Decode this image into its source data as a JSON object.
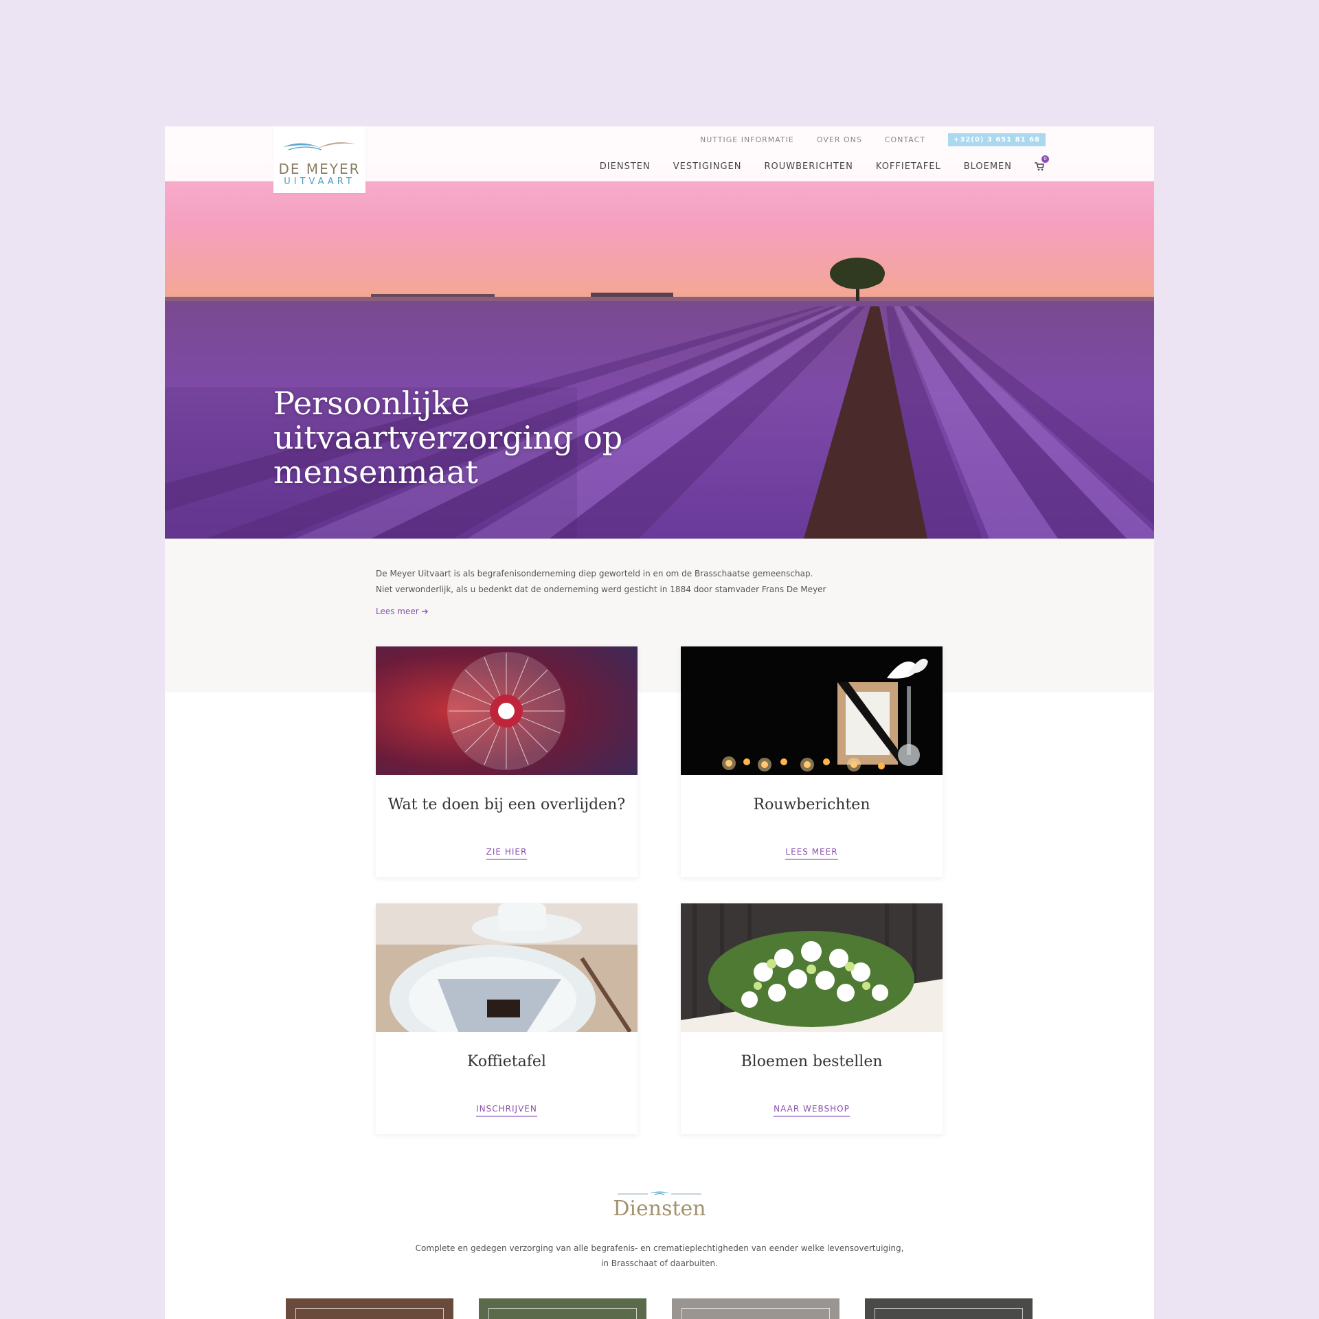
{
  "brand": {
    "line1": "DE MEYER",
    "line2": "UITVAART"
  },
  "topnav": {
    "items": [
      "NUTTIGE INFORMATIE",
      "OVER ONS",
      "CONTACT"
    ],
    "phone": "+32(0) 3 651 81 68"
  },
  "mainnav": {
    "items": [
      "DIENSTEN",
      "VESTIGINGEN",
      "ROUWBERICHTEN",
      "KOFFIETAFEL",
      "BLOEMEN"
    ],
    "cart_count": "0"
  },
  "hero": {
    "title": "Persoonlijke uitvaartverzorging op mensenmaat"
  },
  "intro": {
    "line1": "De Meyer Uitvaart is als begrafenisonderneming diep geworteld in en om de Brasschaatse gemeenschap.",
    "line2": "Niet verwonderlijk, als u bedenkt dat de onderneming werd gesticht in 1884 door stamvader Frans De Meyer",
    "link": "Lees meer"
  },
  "cards": [
    {
      "title": "Wat te doen bij een overlijden?",
      "cta": "ZIE HIER"
    },
    {
      "title": "Rouwberichten",
      "cta": "LEES MEER"
    },
    {
      "title": "Koffietafel",
      "cta": "INSCHRIJVEN"
    },
    {
      "title": "Bloemen bestellen",
      "cta": "NAAR WEBSHOP"
    }
  ],
  "diensten": {
    "title": "Diensten",
    "line1": "Complete en gedegen verzorging van alle begrafenis- en crematieplechtigheden van eender welke levensovertuiging,",
    "line2": "in Brasschaat of daarbuiten."
  },
  "colors": {
    "accent": "#8b4fb0",
    "phone_bg": "#a9d8ef",
    "gold": "#a4926e",
    "page_bg": "#ede4f3"
  }
}
